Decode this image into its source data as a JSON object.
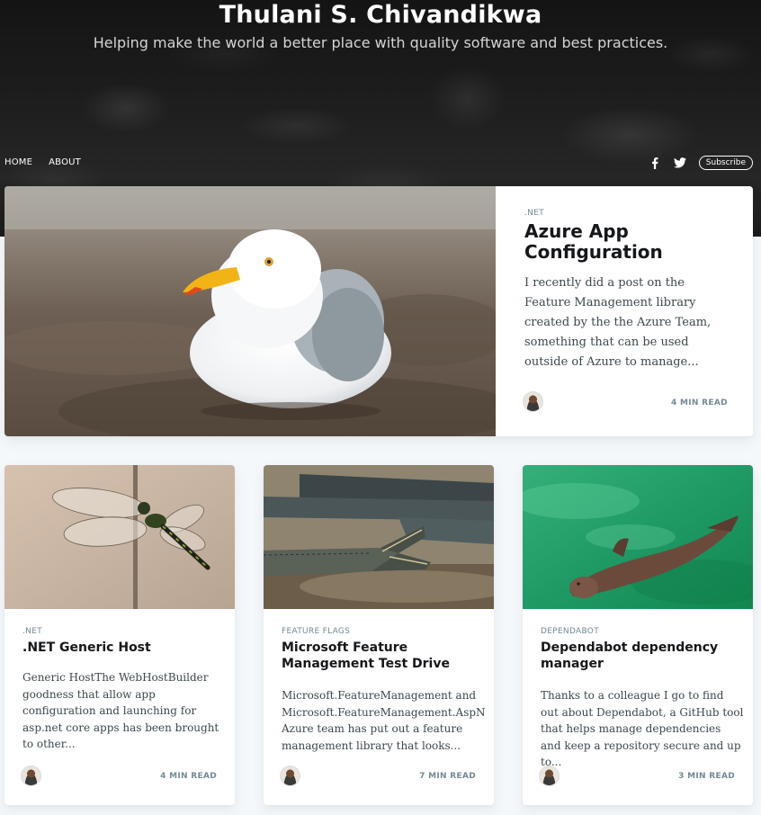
{
  "header": {
    "title": "Thulani S. Chivandikwa",
    "description": "Helping make the world a better place with quality software and best practices.",
    "nav": [
      {
        "label": "HOME"
      },
      {
        "label": "ABOUT"
      }
    ],
    "subscribe_label": "Subscribe",
    "social_icons": [
      "facebook-icon",
      "twitter-icon"
    ]
  },
  "featured": {
    "tag": ".NET",
    "title": "Azure App Configuration",
    "excerpt": "I recently did a post on the Feature Management library created by the the Azure Team, something that can be used outside of Azure to manage...",
    "read_time": "4 MIN READ",
    "image": "seagull-photo"
  },
  "posts": [
    {
      "tag": ".NET",
      "title": ".NET Generic Host",
      "excerpt": "Generic HostThe WebHostBuilder goodness that allow app configuration and launching for asp.net core apps has been brought to other...",
      "read_time": "4 MIN READ",
      "image": "dragonfly-photo"
    },
    {
      "tag": "FEATURE FLAGS",
      "title": "Microsoft Feature Management Test Drive",
      "excerpt": "Microsoft.FeatureManagement and\nMicrosoft.FeatureManagement.AspNetCoreT\nAzure team has put out a feature\nmanagement library that looks...",
      "read_time": "7 MIN READ",
      "image": "crocodiles-photo"
    },
    {
      "tag": "DEPENDABOT",
      "title": "Dependabot dependency manager",
      "excerpt": "Thanks to a colleague I go to find out about Dependabot, a GitHub tool that helps manage dependencies and keep a repository secure and up to...",
      "read_time": "3 MIN READ",
      "image": "seal-photo"
    }
  ],
  "colors": {
    "header_bg": "#1b1b1b",
    "page_bg": "#f4f8fb",
    "tag": "#738a94",
    "title": "#15171a"
  }
}
